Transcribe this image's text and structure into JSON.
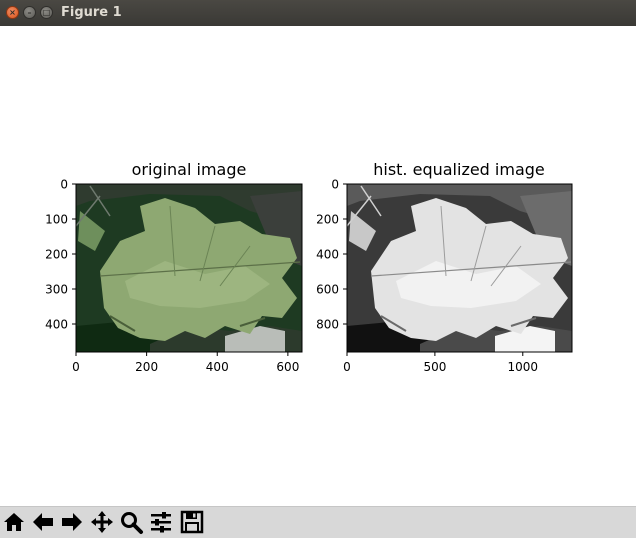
{
  "window": {
    "title": "Figure 1"
  },
  "window_buttons": {
    "close": "×",
    "minimize": "–",
    "maximize": "□"
  },
  "chart_data": [
    {
      "type": "image",
      "title": "original image",
      "xticks": [
        "0",
        "200",
        "400",
        "600"
      ],
      "yticks": [
        "0",
        "100",
        "200",
        "300",
        "400"
      ],
      "xlim": [
        0,
        640
      ],
      "ylim": [
        480,
        0
      ]
    },
    {
      "type": "image",
      "title": "hist. equalized image",
      "xticks": [
        "0",
        "500",
        "1000"
      ],
      "yticks": [
        "0",
        "200",
        "400",
        "600",
        "800"
      ],
      "xlim": [
        0,
        1280
      ],
      "ylim": [
        960,
        0
      ]
    }
  ],
  "toolbar": {
    "buttons": [
      {
        "name": "home-button",
        "icon": "home-icon"
      },
      {
        "name": "back-button",
        "icon": "arrow-left-icon"
      },
      {
        "name": "forward-button",
        "icon": "arrow-right-icon"
      },
      {
        "name": "pan-button",
        "icon": "move-icon"
      },
      {
        "name": "zoom-button",
        "icon": "magnifier-icon"
      },
      {
        "name": "configure-subplots-button",
        "icon": "sliders-icon"
      },
      {
        "name": "save-button",
        "icon": "floppy-icon"
      }
    ]
  }
}
